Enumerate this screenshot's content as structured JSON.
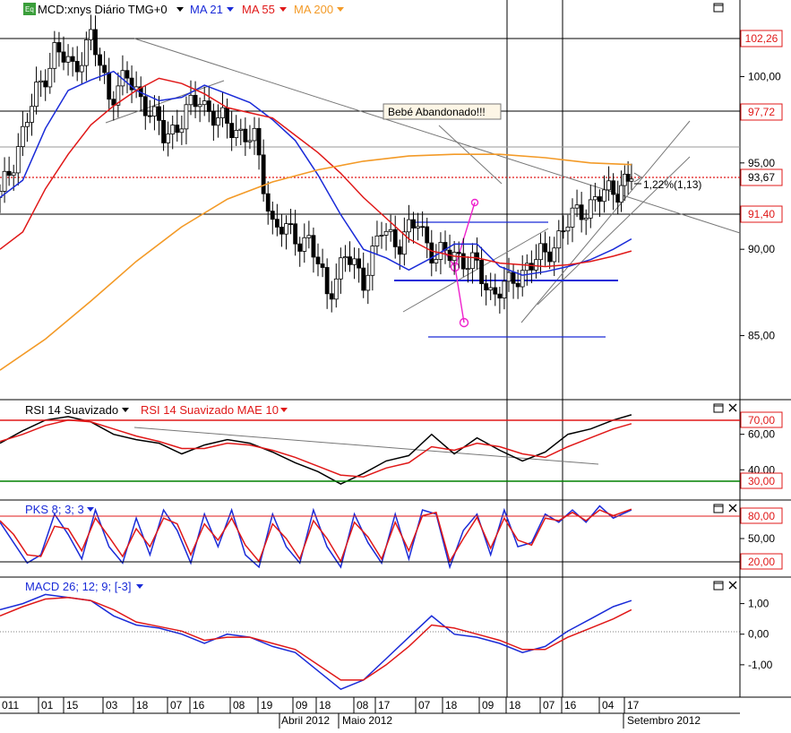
{
  "colors": {
    "price": "#000000",
    "ma21": "#1a2bd8",
    "ma55": "#e01818",
    "ma200": "#f39a27",
    "rsi": "#000000",
    "rsi_signal": "#e01818",
    "stoch_k": "#1a2bd8",
    "stoch_d": "#e01818",
    "macd": "#1a2bd8",
    "macd_signal": "#e01818",
    "hl_red": "#e01818",
    "hl_green": "#008000",
    "annot": "#ee22cc",
    "label_red_text": "#e01818",
    "label_bg": "#ffffff"
  },
  "main": {
    "symbol_icon": "Eq",
    "title": "MCD:xnys Diário TMG+0",
    "ma21_label": "MA 21",
    "ma55_label": "MA 55",
    "ma200_label": "MA 200",
    "annotation": "Bebé Abandonado!!!",
    "pct_label": "1,22%(1,13)",
    "price_labels": [
      "102,26",
      "97,72",
      "93,67",
      "91,40"
    ]
  },
  "rsi": {
    "title": "RSI 14 Suavizado",
    "signal_title": "RSI 14 Suavizado MAE 10",
    "level_labels": [
      "70,00",
      "30,00"
    ]
  },
  "stoch": {
    "title": "PKS 8; 3; 3",
    "level_labels": [
      "80,00",
      "20,00"
    ]
  },
  "macd": {
    "title": "MACD 26; 12; 9; [-3]"
  },
  "x_axis": {
    "top_labels": [
      "011",
      "01",
      "15",
      "03",
      "18",
      "07",
      "16",
      "08",
      "19",
      "09",
      "18",
      "08",
      "17",
      "07",
      "18",
      "09",
      "18",
      "07",
      "16",
      "04",
      "17"
    ],
    "month_labels": [
      "Abril 2012",
      "Maio 2012",
      "Setembro 2012"
    ]
  },
  "chart_data": [
    {
      "type": "line",
      "panel": "price",
      "title": "MCD:xnys Diário TMG+0",
      "ylim": [
        81.5,
        103.5
      ],
      "y_ticks": [
        85,
        90,
        95,
        100
      ],
      "y_tick_labels": [
        "85,00",
        "90,00",
        "95,00",
        "100,00"
      ],
      "highlighted_levels": [
        102.26,
        97.72,
        93.67,
        91.4
      ],
      "x_index_range": [
        0,
        140
      ],
      "series": [
        {
          "name": "MA 21",
          "x": [
            0,
            5,
            10,
            15,
            20,
            25,
            30,
            35,
            40,
            45,
            50,
            55,
            60,
            65,
            70,
            75,
            80,
            85,
            90,
            95,
            100,
            105,
            110,
            115,
            120,
            125,
            130,
            135,
            139
          ],
          "values": [
            93.0,
            94.0,
            97.0,
            99.2,
            99.8,
            100.3,
            99.2,
            98.6,
            98.8,
            99.5,
            99.0,
            98.5,
            97.5,
            96.3,
            94.3,
            92.0,
            90.0,
            89.5,
            88.8,
            89.5,
            90.3,
            90.3,
            89.0,
            88.5,
            88.7,
            89.0,
            89.4,
            90.0,
            90.6
          ]
        },
        {
          "name": "MA 55",
          "x": [
            0,
            5,
            10,
            15,
            20,
            25,
            30,
            35,
            40,
            45,
            50,
            55,
            60,
            65,
            70,
            75,
            80,
            85,
            90,
            95,
            100,
            105,
            110,
            115,
            120,
            125,
            130,
            135,
            139
          ],
          "values": [
            90.0,
            91.0,
            93.5,
            95.5,
            97.2,
            98.3,
            99.2,
            99.9,
            99.6,
            99.0,
            98.2,
            97.9,
            97.6,
            96.6,
            95.6,
            94.4,
            93.0,
            91.8,
            90.6,
            89.9,
            89.6,
            89.5,
            89.2,
            89.1,
            89.0,
            89.1,
            89.3,
            89.6,
            89.9
          ]
        },
        {
          "name": "MA 200",
          "x": [
            0,
            10,
            20,
            30,
            40,
            50,
            60,
            70,
            80,
            90,
            100,
            110,
            120,
            130,
            139
          ],
          "values": [
            83.0,
            84.8,
            87.0,
            89.3,
            91.3,
            92.9,
            93.9,
            94.6,
            95.1,
            95.4,
            95.5,
            95.5,
            95.3,
            95.0,
            94.9
          ]
        },
        {
          "name": "Close",
          "x": [
            0,
            4,
            8,
            12,
            16,
            20,
            24,
            28,
            32,
            36,
            40,
            44,
            48,
            52,
            56,
            60,
            64,
            68,
            72,
            76,
            80,
            84,
            88,
            92,
            96,
            100,
            104,
            108,
            112,
            116,
            120,
            124,
            128,
            132,
            136,
            139
          ],
          "values": [
            93.0,
            96.0,
            99.0,
            101.5,
            100.5,
            102.2,
            99.0,
            99.8,
            98.5,
            96.5,
            97.5,
            98.8,
            97.4,
            97.0,
            96.2,
            91.5,
            90.8,
            90.5,
            87.5,
            89.5,
            88.4,
            91.0,
            90.5,
            91.5,
            89.5,
            89.8,
            89.1,
            87.6,
            87.8,
            89.1,
            89.6,
            91.2,
            92.3,
            93.0,
            93.6,
            94.1
          ]
        }
      ]
    },
    {
      "type": "line",
      "panel": "rsi",
      "title": "RSI 14 Suavizado",
      "ylim": [
        24,
        78
      ],
      "y_ticks": [
        40,
        60
      ],
      "y_tick_labels": [
        "40,00",
        "60,00"
      ],
      "levels": [
        70,
        30
      ],
      "x_index_range": [
        0,
        140
      ],
      "series": [
        {
          "name": "RSI 14 Suavizado",
          "x": [
            0,
            5,
            10,
            15,
            20,
            25,
            30,
            35,
            40,
            45,
            50,
            55,
            60,
            65,
            70,
            75,
            80,
            85,
            90,
            95,
            100,
            105,
            110,
            115,
            120,
            125,
            130,
            135,
            139
          ],
          "values": [
            55,
            62,
            68,
            70,
            67,
            60,
            57,
            55,
            49,
            54,
            57,
            55,
            50,
            44,
            39,
            32,
            38,
            45,
            48,
            60,
            49,
            58,
            51,
            45,
            50,
            60,
            63,
            68,
            71
          ]
        },
        {
          "name": "RSI 14 Suavizado MAE 10",
          "x": [
            0,
            5,
            10,
            15,
            20,
            25,
            30,
            35,
            40,
            45,
            50,
            55,
            60,
            65,
            70,
            75,
            80,
            85,
            90,
            95,
            100,
            105,
            110,
            115,
            120,
            125,
            130,
            135,
            139
          ],
          "values": [
            56,
            60,
            65,
            68,
            67,
            63,
            59,
            56,
            52,
            52,
            55,
            54,
            51,
            47,
            42,
            37,
            36,
            41,
            44,
            53,
            51,
            55,
            53,
            49,
            47,
            53,
            58,
            63,
            66
          ]
        }
      ]
    },
    {
      "type": "line",
      "panel": "stochastic",
      "title": "PKS 8; 3; 3",
      "ylim": [
        5,
        95
      ],
      "y_ticks": [
        50
      ],
      "y_tick_labels": [
        "50,00"
      ],
      "levels": [
        80,
        20
      ],
      "x_index_range": [
        0,
        140
      ],
      "series": [
        {
          "name": "%K",
          "x": [
            0,
            3,
            6,
            9,
            12,
            15,
            18,
            21,
            24,
            27,
            30,
            33,
            36,
            39,
            42,
            45,
            48,
            51,
            54,
            57,
            60,
            63,
            66,
            69,
            72,
            75,
            78,
            81,
            84,
            87,
            90,
            93,
            96,
            99,
            102,
            105,
            108,
            111,
            114,
            117,
            120,
            123,
            126,
            129,
            132,
            135,
            139
          ],
          "values": [
            70,
            45,
            20,
            30,
            80,
            55,
            25,
            85,
            40,
            20,
            75,
            30,
            85,
            60,
            20,
            80,
            40,
            85,
            30,
            15,
            80,
            40,
            20,
            85,
            40,
            15,
            80,
            45,
            20,
            80,
            25,
            85,
            80,
            15,
            60,
            80,
            30,
            85,
            40,
            45,
            80,
            70,
            85,
            70,
            90,
            75,
            85
          ]
        },
        {
          "name": "%D",
          "x": [
            0,
            3,
            6,
            9,
            12,
            15,
            18,
            21,
            24,
            27,
            30,
            33,
            36,
            39,
            42,
            45,
            48,
            51,
            54,
            57,
            60,
            63,
            66,
            69,
            72,
            75,
            78,
            81,
            84,
            87,
            90,
            93,
            96,
            99,
            102,
            105,
            108,
            111,
            114,
            117,
            120,
            123,
            126,
            129,
            132,
            135,
            139
          ],
          "values": [
            72,
            55,
            30,
            28,
            65,
            62,
            35,
            75,
            52,
            28,
            62,
            40,
            75,
            68,
            30,
            68,
            48,
            75,
            42,
            22,
            68,
            50,
            25,
            72,
            50,
            22,
            70,
            52,
            25,
            70,
            35,
            78,
            82,
            22,
            50,
            76,
            38,
            75,
            48,
            42,
            75,
            72,
            82,
            72,
            85,
            78,
            86
          ]
        }
      ]
    },
    {
      "type": "line",
      "panel": "macd",
      "title": "MACD 26; 12; 9; [-3]",
      "ylim": [
        -2.0,
        1.75
      ],
      "y_ticks": [
        -1,
        0,
        1
      ],
      "y_tick_labels": [
        "-1,00",
        "0,00",
        "1,00"
      ],
      "x_index_range": [
        0,
        140
      ],
      "series": [
        {
          "name": "MACD",
          "x": [
            0,
            5,
            10,
            15,
            20,
            25,
            30,
            35,
            40,
            45,
            50,
            55,
            60,
            65,
            70,
            75,
            80,
            85,
            90,
            95,
            100,
            105,
            110,
            115,
            120,
            125,
            130,
            135,
            139
          ],
          "values": [
            0.8,
            1.0,
            1.3,
            1.2,
            1.1,
            0.6,
            0.3,
            0.2,
            0.0,
            -0.3,
            0.0,
            -0.1,
            -0.4,
            -0.6,
            -1.2,
            -1.8,
            -1.5,
            -0.8,
            -0.1,
            0.6,
            0.0,
            -0.1,
            -0.3,
            -0.6,
            -0.4,
            0.1,
            0.5,
            0.9,
            1.1
          ]
        },
        {
          "name": "Signal",
          "x": [
            0,
            5,
            10,
            15,
            20,
            25,
            30,
            35,
            40,
            45,
            50,
            55,
            60,
            65,
            70,
            75,
            80,
            85,
            90,
            95,
            100,
            105,
            110,
            115,
            120,
            125,
            130,
            135,
            139
          ],
          "values": [
            0.6,
            0.9,
            1.15,
            1.2,
            1.1,
            0.8,
            0.4,
            0.25,
            0.1,
            -0.2,
            -0.1,
            -0.1,
            -0.3,
            -0.5,
            -1.0,
            -1.5,
            -1.5,
            -1.0,
            -0.4,
            0.3,
            0.2,
            0.0,
            -0.2,
            -0.5,
            -0.5,
            -0.1,
            0.2,
            0.5,
            0.8
          ]
        }
      ]
    }
  ]
}
